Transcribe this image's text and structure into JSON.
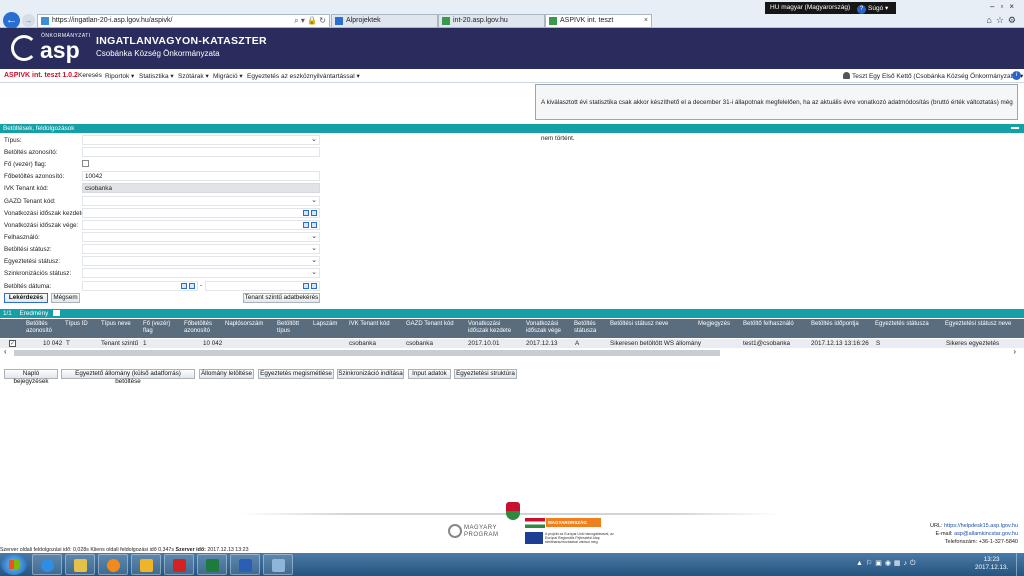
{
  "browser": {
    "url": "https://ingatlan-20-i.asp.lgov.hu/aspivk/",
    "tabs": [
      {
        "label": "Alprojektek"
      },
      {
        "label": "int-20.asp.lgov.hu"
      },
      {
        "label": "ASPIVK int. teszt"
      }
    ],
    "language": "HU magyar (Magyarország)",
    "help": "Súgó"
  },
  "header": {
    "logo_small": "ÖNKORMÁNYZATI",
    "logo": "asp",
    "title": "INGATLANVAGYON-KATASZTER",
    "subtitle": "Csobánka Község Önkormányzata"
  },
  "menu": {
    "brand": "ASPIVK int. teszt 1.0.2",
    "items": [
      {
        "label": "Keresés"
      },
      {
        "label": "Riportok ▾"
      },
      {
        "label": "Statisztika ▾"
      },
      {
        "label": "Szótárak ▾"
      },
      {
        "label": "Migráció ▾"
      },
      {
        "label": "Egyeztetés az eszköznyilvántartással ▾"
      }
    ],
    "user": "Teszt Egy Első Kettő (Csobánka Község Önkormányzata) ▾"
  },
  "notice": "A kiválasztott évi statisztika csak akkor készíthető el a december 31-i állapotnak megfelelően, ha az aktuális évre vonatkozó adatmódosítás (bruttó érték változtatás) még nem történt.",
  "filter_section": {
    "title": "Betöltések, feldolgozások",
    "fields": {
      "tipus": {
        "label": "Típus:",
        "value": ""
      },
      "betoltes_azonosito": {
        "label": "Betöltés azonosító:",
        "value": ""
      },
      "fo_flag": {
        "label": "Fő (vezér) flag:"
      },
      "fobetoltes_azonosito": {
        "label": "Főbetöltés azonosító:",
        "value": "10042"
      },
      "ivk_tenant_kod": {
        "label": "IVK Tenant kód:",
        "value": "csobanka"
      },
      "gazd_tenant_kod": {
        "label": "GAZD Tenant kód:",
        "value": ""
      },
      "vonatkozasi_kezdete": {
        "label": "Vonatkozási időszak kezdete:",
        "value": ""
      },
      "vonatkozasi_vege": {
        "label": "Vonatkozási időszak vége:",
        "value": ""
      },
      "felhasznalo": {
        "label": "Felhasználó:",
        "value": ""
      },
      "betoltesi_statusz": {
        "label": "Betöltési státusz:",
        "value": ""
      },
      "egyeztetesi_statusz": {
        "label": "Egyeztetési státusz:",
        "value": ""
      },
      "szinkronizacios_statusz": {
        "label": "Szinkronizációs státusz:",
        "value": ""
      },
      "betoltes_datuma": {
        "label": "Betöltés dátuma:",
        "separator": "-"
      }
    },
    "buttons": {
      "query": "Lekérdezés",
      "cancel": "Mégsem",
      "tenant_request": "Tenant szintű adatbekérés"
    }
  },
  "results": {
    "pager": "1/1",
    "title": "Eredmény",
    "columns": [
      "Betöltés azonosító",
      "Típus ID",
      "Típus neve",
      "Fő (vezér) flag",
      "Főbetöltés azonosító",
      "Naplósorszám",
      "Betöltött típus",
      "Lapszám",
      "IVK Tenant kód",
      "GAZD Tenant kód",
      "Vonatkozási időszak kezdete",
      "Vonatkozási időszak vége",
      "Betöltés státusza",
      "Betöltési státusz neve",
      "Megjegyzés",
      "Betöltő felhasználó",
      "Betöltés időpontja",
      "Egyeztetés státusza",
      "Egyeztetési státusz neve"
    ],
    "rows": [
      [
        "10 042",
        "T",
        "Tenant szintű",
        "1",
        "10 042",
        "",
        "",
        "",
        "csobanka",
        "csobanka",
        "2017.10.01",
        "2017.12.13",
        "A",
        "Sikeresen betöltött WS állomány",
        "",
        "test1@csobanka",
        "2017.12.13 13:16:26",
        "S",
        "Sikeres egyeztetés"
      ]
    ],
    "check_mark": "✓"
  },
  "action_buttons": [
    "Napló bejegyzések",
    "Egyeztető állomány (külső adatforrás) betöltése",
    "Állomány letöltése",
    "Egyeztetés megismétlése",
    "Szinkronizáció indítása",
    "Input adatok",
    "Egyeztetési struktúra"
  ],
  "footer": {
    "program_logo": "MAGYARY PROGRAM",
    "hu_band": "MAGYARORSZÁG MEGÚJUL",
    "eu_text": "A projekt az Európai Unió támogatásával, az Európai Regionális Fejlesztési Alap társfinanszírozásával valósul meg.",
    "url_label": "URL:",
    "url": "https://helpdesk15.asp.lgov.hu",
    "email_label": "E-mail:",
    "email": "asp@allamkincstar.gov.hu",
    "phone": "Telefonszám: +36-1-327-5840",
    "status_line": "Szerver oldali feldolgozási idő: 0,028s Kliens oldali feldolgozási idő 0,347s",
    "server_time_label": "Szerver idő:",
    "server_time": "2017.12.13 13:23"
  },
  "taskbar": {
    "time": "13:23",
    "date": "2017.12.13."
  },
  "colors": {
    "header_bg": "#2b2c5e",
    "section_teal": "#15a0a8",
    "grid_header": "#5a6d7f",
    "brand_red": "#c8102e"
  }
}
